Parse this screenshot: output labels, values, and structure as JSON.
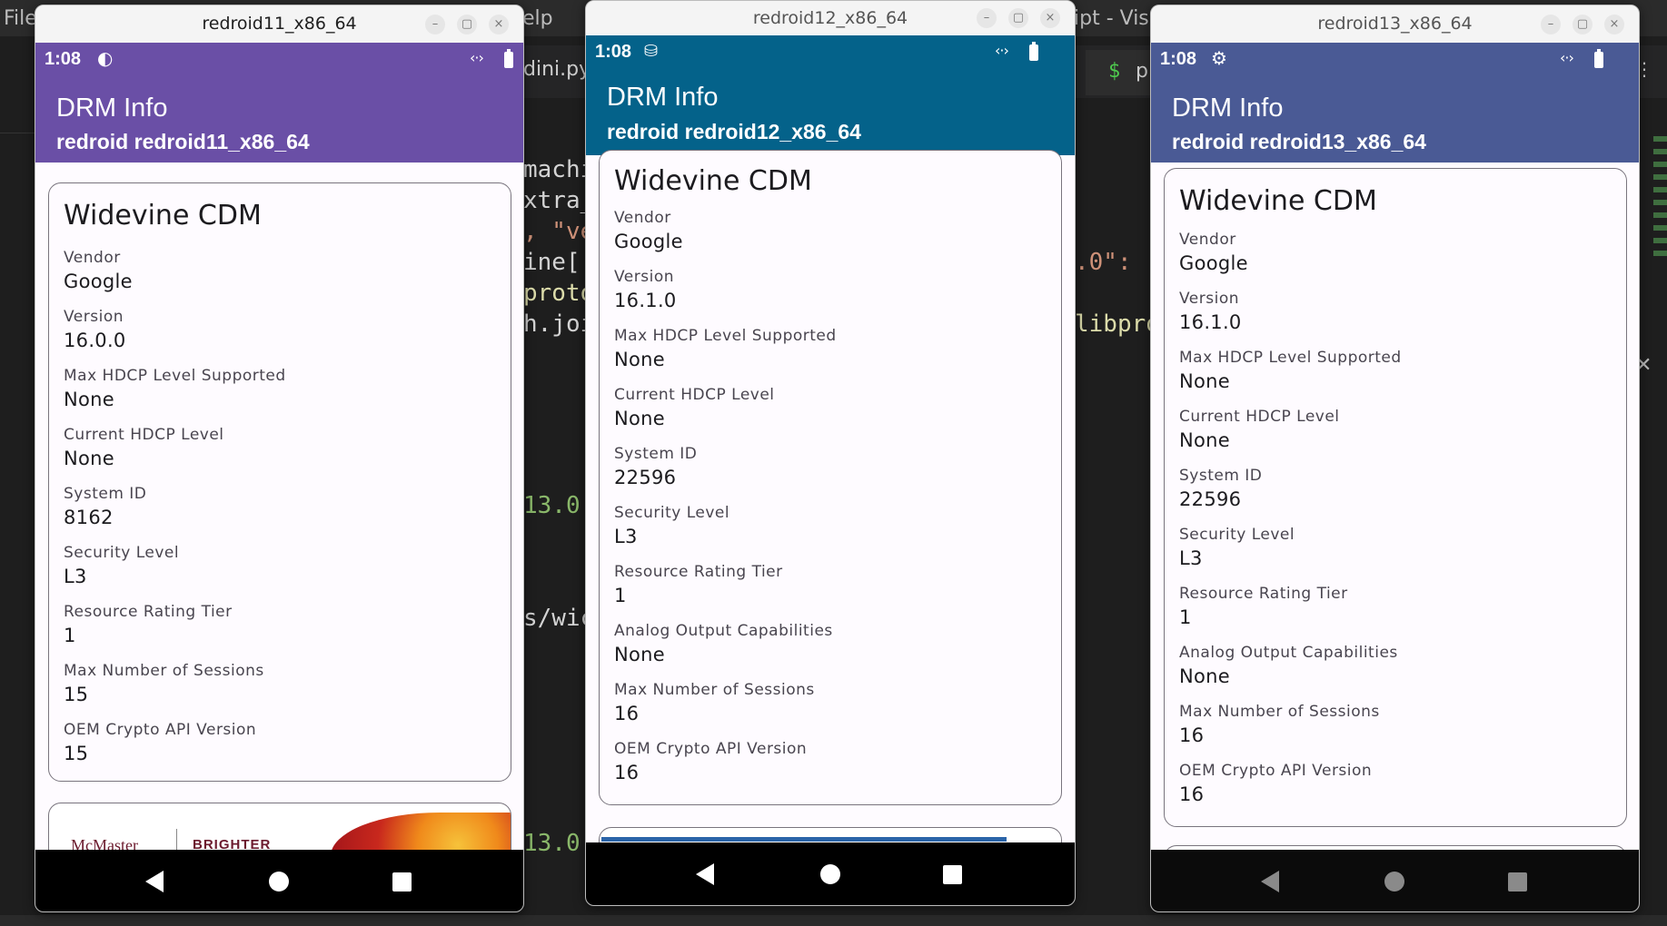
{
  "background": {
    "menu_file": "File",
    "menu_help": "elp",
    "window_title_fragment": "ipt - Visu",
    "tab_filename": "dini.py",
    "terminal_prompt": "$",
    "terminal_text": "p",
    "code_lines": [
      "machi",
      "xtra_",
      ", \"ve",
      "ine[(",
      "proto",
      "h.joi",
      "13.0.",
      "s/wic",
      "13.0."
    ],
    "code_right_1": ".0\":",
    "code_right_2": "libpro"
  },
  "emulators": [
    {
      "window_title": "redroid11_x86_64",
      "time": "1:08",
      "status_icon": "data-saver-icon",
      "app_title": "DRM Info",
      "app_subtitle": "redroid redroid11_x86_64",
      "appbar_color": "#6a4fa6",
      "card_title": "Widevine CDM",
      "fields": [
        {
          "label": "Vendor",
          "value": "Google"
        },
        {
          "label": "Version",
          "value": "16.0.0"
        },
        {
          "label": "Max HDCP Level Supported",
          "value": "None"
        },
        {
          "label": "Current HDCP Level",
          "value": "None"
        },
        {
          "label": "System ID",
          "value": "8162"
        },
        {
          "label": "Security Level",
          "value": "L3"
        },
        {
          "label": "Resource Rating Tier",
          "value": "1"
        },
        {
          "label": "Max Number of Sessions",
          "value": "15"
        },
        {
          "label": "OEM Crypto API Version",
          "value": "15"
        }
      ],
      "next_card_logo_1": "McMaster",
      "next_card_logo_2": "BRIGHTER"
    },
    {
      "window_title": "redroid12_x86_64",
      "time": "1:08",
      "status_icon": "database-icon",
      "app_title": "DRM Info",
      "app_subtitle": "redroid redroid12_x86_64",
      "appbar_color": "#04628a",
      "card_title": "Widevine CDM",
      "fields": [
        {
          "label": "Vendor",
          "value": "Google"
        },
        {
          "label": "Version",
          "value": "16.1.0"
        },
        {
          "label": "Max HDCP Level Supported",
          "value": "None"
        },
        {
          "label": "Current HDCP Level",
          "value": "None"
        },
        {
          "label": "System ID",
          "value": "22596"
        },
        {
          "label": "Security Level",
          "value": "L3"
        },
        {
          "label": "Resource Rating Tier",
          "value": "1"
        },
        {
          "label": "Analog Output Capabilities",
          "value": "None"
        },
        {
          "label": "Max Number of Sessions",
          "value": "16"
        },
        {
          "label": "OEM Crypto API Version",
          "value": "16"
        }
      ]
    },
    {
      "window_title": "redroid13_x86_64",
      "time": "1:08",
      "status_icon": "gear-icon",
      "app_title": "DRM Info",
      "app_subtitle": "redroid redroid13_x86_64",
      "appbar_color": "#4a5a95",
      "card_title": "Widevine CDM",
      "fields": [
        {
          "label": "Vendor",
          "value": "Google"
        },
        {
          "label": "Version",
          "value": "16.1.0"
        },
        {
          "label": "Max HDCP Level Supported",
          "value": "None"
        },
        {
          "label": "Current HDCP Level",
          "value": "None"
        },
        {
          "label": "System ID",
          "value": "22596"
        },
        {
          "label": "Security Level",
          "value": "L3"
        },
        {
          "label": "Resource Rating Tier",
          "value": "1"
        },
        {
          "label": "Analog Output Capabilities",
          "value": "None"
        },
        {
          "label": "Max Number of Sessions",
          "value": "16"
        },
        {
          "label": "OEM Crypto API Version",
          "value": "16"
        }
      ]
    }
  ],
  "window_buttons": {
    "minimize": "–",
    "maximize": "▢",
    "close": "×"
  },
  "status_right": "‹·›"
}
